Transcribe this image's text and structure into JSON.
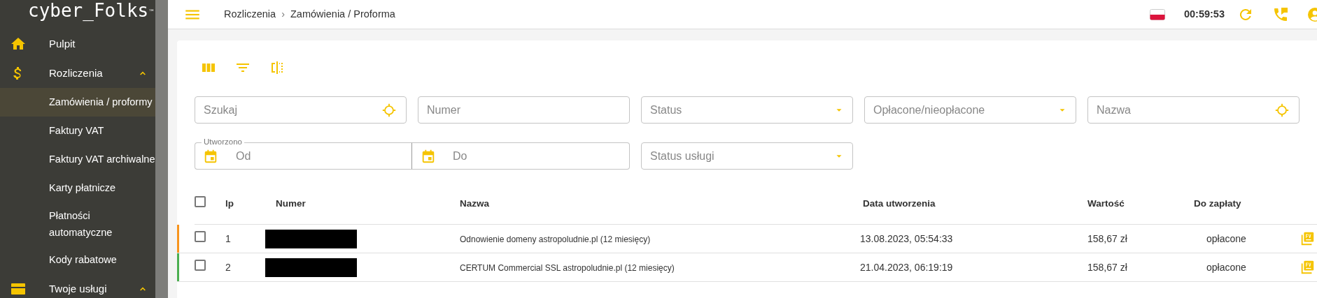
{
  "sidebar": {
    "logo": "cyber_Folks",
    "logo_mark": "™",
    "items": [
      {
        "label": "Pulpit"
      },
      {
        "label": "Rozliczenia",
        "expanded": true,
        "children": [
          {
            "label": "Zamówienia / proformy",
            "selected": true
          },
          {
            "label": "Faktury VAT",
            "selected": false
          },
          {
            "label": "Faktury VAT archiwalne",
            "selected": false
          },
          {
            "label": "Karty płatnicze",
            "selected": false
          },
          {
            "label": "Płatności automatyczne",
            "selected": false
          },
          {
            "label": "Kody rabatowe",
            "selected": false
          }
        ]
      },
      {
        "label": "Twoje usługi",
        "expanded": true
      }
    ]
  },
  "topbar": {
    "breadcrumb": [
      "Rozliczenia",
      "Zamówienia / Proforma"
    ],
    "separator": "›",
    "timer": "00:59:53"
  },
  "filters": [
    {
      "kind": "search",
      "placeholder": "Szukaj"
    },
    {
      "kind": "text",
      "placeholder": "Numer"
    },
    {
      "kind": "select",
      "placeholder": "Status"
    },
    {
      "kind": "select",
      "placeholder": "Opłacone/nieopłacone"
    },
    {
      "kind": "search",
      "placeholder": "Nazwa"
    },
    {
      "kind": "daterange",
      "label": "Utworzono",
      "from_placeholder": "Od",
      "to_placeholder": "Do"
    },
    {
      "kind": "select",
      "placeholder": "Status usługi"
    }
  ],
  "table": {
    "select_all_checked": false,
    "columns": [
      "lp",
      "Numer",
      "Nazwa",
      "Data utworzenia",
      "Wartość",
      "Do zapłaty"
    ],
    "rows": [
      {
        "checked": false,
        "color": "#f7941d",
        "lp": "1",
        "numer_redacted": true,
        "nazwa": "Odnowienie domeny astropoludnie.pl (12 miesięcy)",
        "data": "13.08.2023, 05:54:33",
        "wartosc": "158,67 zł",
        "do_zaplaty": "opłacone"
      },
      {
        "checked": false,
        "color": "#4caf50",
        "lp": "2",
        "numer_redacted": true,
        "nazwa": "CERTUM Commercial SSL astropoludnie.pl (12 miesięcy)",
        "data": "21.04.2023, 06:19:19",
        "wartosc": "158,67 zł",
        "do_zaplaty": "opłacone"
      }
    ]
  }
}
